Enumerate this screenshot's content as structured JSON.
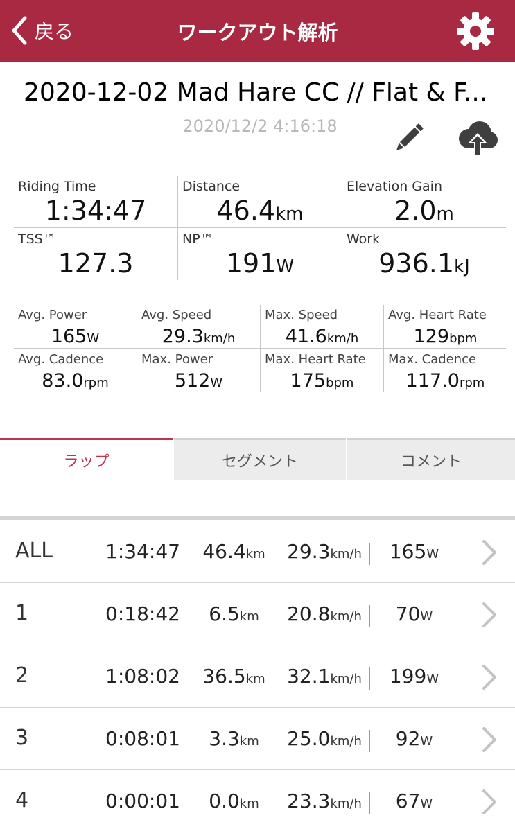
{
  "header": {
    "back_label": "戻る",
    "title": "ワークアウト解析",
    "color": "#a82941"
  },
  "workout": {
    "title": "2020-12-02 Mad Hare CC // Flat & F...",
    "datetime": "2020/12/2 4:16:18"
  },
  "summary": [
    {
      "label": "Riding Time",
      "value": "1:34:47",
      "unit": ""
    },
    {
      "label": "Distance",
      "value": "46.4",
      "unit": "km"
    },
    {
      "label": "Elevation Gain",
      "value": "2.0",
      "unit": "m"
    },
    {
      "label": "TSS™",
      "value": "127.3",
      "unit": ""
    },
    {
      "label": "NP™",
      "value": "191",
      "unit": "W"
    },
    {
      "label": "Work",
      "value": "936.1",
      "unit": "kJ"
    }
  ],
  "details": [
    {
      "label": "Avg. Power",
      "value": "165",
      "unit": "W"
    },
    {
      "label": "Avg. Speed",
      "value": "29.3",
      "unit": "km/h"
    },
    {
      "label": "Max. Speed",
      "value": "41.6",
      "unit": "km/h"
    },
    {
      "label": "Avg. Heart Rate",
      "value": "129",
      "unit": "bpm"
    },
    {
      "label": "Avg. Cadence",
      "value": "83.0",
      "unit": "rpm"
    },
    {
      "label": "Max. Power",
      "value": "512",
      "unit": "W"
    },
    {
      "label": "Max. Heart Rate",
      "value": "175",
      "unit": "bpm"
    },
    {
      "label": "Max. Cadence",
      "value": "117.0",
      "unit": "rpm"
    }
  ],
  "tabs": [
    {
      "label": "ラップ",
      "active": true
    },
    {
      "label": "セグメント",
      "active": false
    },
    {
      "label": "コメント",
      "active": false
    }
  ],
  "laps": [
    {
      "name": "ALL",
      "time": "1:34:47",
      "distance": "46.4",
      "distance_unit": "km",
      "speed": "29.3",
      "speed_unit": "km/h",
      "power": "165",
      "power_unit": "W"
    },
    {
      "name": "1",
      "time": "0:18:42",
      "distance": "6.5",
      "distance_unit": "km",
      "speed": "20.8",
      "speed_unit": "km/h",
      "power": "70",
      "power_unit": "W"
    },
    {
      "name": "2",
      "time": "1:08:02",
      "distance": "36.5",
      "distance_unit": "km",
      "speed": "32.1",
      "speed_unit": "km/h",
      "power": "199",
      "power_unit": "W"
    },
    {
      "name": "3",
      "time": "0:08:01",
      "distance": "3.3",
      "distance_unit": "km",
      "speed": "25.0",
      "speed_unit": "km/h",
      "power": "92",
      "power_unit": "W"
    },
    {
      "name": "4",
      "time": "0:00:01",
      "distance": "0.0",
      "distance_unit": "km",
      "speed": "23.3",
      "speed_unit": "km/h",
      "power": "67",
      "power_unit": "W"
    }
  ]
}
